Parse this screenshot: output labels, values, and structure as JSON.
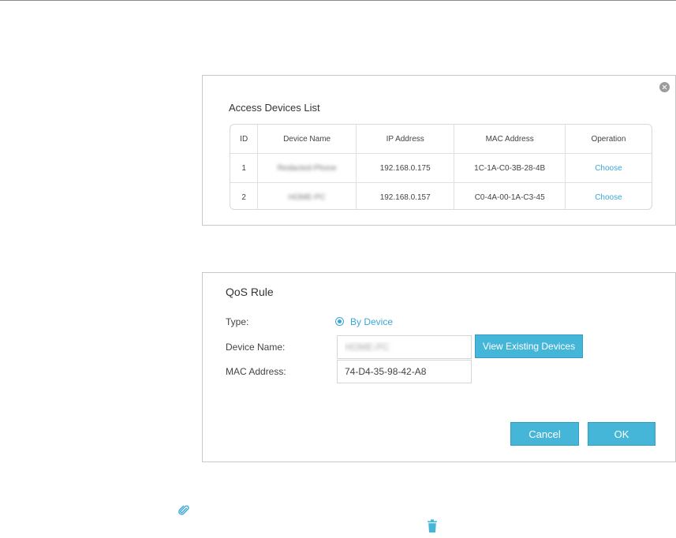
{
  "access_devices": {
    "title": "Access Devices List",
    "columns": [
      "ID",
      "Device Name",
      "IP Address",
      "MAC Address",
      "Operation"
    ],
    "rows": [
      {
        "id": "1",
        "device_name": "Redacted-Phone",
        "ip": "192.168.0.175",
        "mac": "1C-1A-C0-3B-28-4B",
        "operation": "Choose"
      },
      {
        "id": "2",
        "device_name": "HOME-PC",
        "ip": "192.168.0.157",
        "mac": "C0-4A-00-1A-C3-45",
        "operation": "Choose"
      }
    ]
  },
  "qos_rule": {
    "title": "QoS Rule",
    "type_label": "Type:",
    "type_option": "By Device",
    "device_name_label": "Device Name:",
    "device_name_value": "HOME-PC",
    "mac_label": "MAC Address:",
    "mac_value": "74-D4-35-98-42-A8",
    "view_devices_label": "View Existing Devices",
    "cancel_label": "Cancel",
    "ok_label": "OK"
  },
  "colors": {
    "accent": "#3aa7d6",
    "button": "#45b6d8"
  },
  "icons": [
    "close-icon",
    "radio-selected-icon",
    "paperclip-icon",
    "trash-icon"
  ]
}
